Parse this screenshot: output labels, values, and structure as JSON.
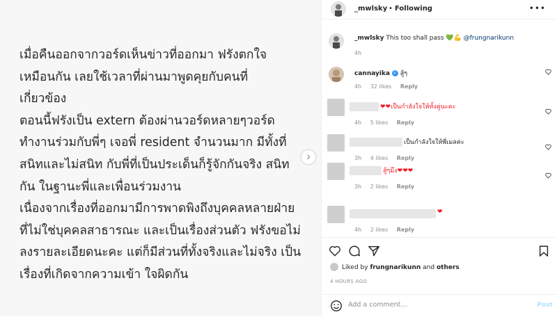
{
  "post_image": {
    "lines": [
      "เมื่อคืนออกจากวอร์ดเห็นข่าวที่ออกมา ฟรังตกใจ",
      "เหมือนกัน  เลยใช้เวลาที่ผ่านมาพูดคุยกับคนที่",
      "เกี่ยวข้อง",
      "ตอนนี้ฟรังเป็น extern ต้องผ่านวอร์ดหลายๆวอร์ด",
      "ทำงานร่วมกับพี่ๆ เจอพี่ resident จำนวนมาก มีทั้งที่",
      "สนิทและไม่สนิท กับพี่ที่เป็นประเด็นก็รู้จักกันจริง สนิท",
      "กัน  ในฐานะพี่และเพื่อนร่วมงาน",
      "เนื่องจากเรื่องที่ออกมามีการพาดพิงถึงบุคคลหลายฝ่าย",
      "ที่ไม่ใช่บุคคลสาธารณะ และเป็นเรื่องส่วนตัว ฟรังขอไม่",
      "ลงรายละเอียดนะคะ แต่ก็มีส่วนที่ทั้งจริงและไม่จริง เป็น",
      "เรื่องที่เกิดจากความเข้า ใจผิดกัน"
    ]
  },
  "header": {
    "username": "_mwlsky",
    "separator": "•",
    "follow_status": "Following",
    "more_icon": "more-horizontal-icon"
  },
  "caption": {
    "username": "_mwlsky",
    "text": "This too shall pass",
    "emojis": "💚💪",
    "mention": "@frungnarikunn",
    "time": "4h"
  },
  "comments": [
    {
      "username": "cannayika",
      "verified": true,
      "text": "สู้ๆ",
      "time": "4h",
      "likes": "32 likes",
      "reply": "Reply"
    },
    {
      "username": "",
      "text": "❤❤เป็นกำลังใจให้ทั้งคู่นะคะ",
      "time": "4h",
      "likes": "5 likes",
      "reply": "Reply"
    },
    {
      "username": "",
      "text": "เป็นกำลังใจให้พี่เมลค่ะ",
      "time": "3h",
      "likes": "4 likes",
      "reply": "Reply"
    },
    {
      "username": "",
      "text": "สู้ๆมึง❤❤❤",
      "time": "3h",
      "likes": "2 likes",
      "reply": "Reply"
    },
    {
      "username": "",
      "text": "❤",
      "time": "4h",
      "likes": "2 likes",
      "reply": "Reply"
    }
  ],
  "likes_line": {
    "prefix": "Liked by",
    "user": "frungnarikunn",
    "joiner": "and",
    "others": "others"
  },
  "timestamp": "4 HOURS AGO",
  "add_comment": {
    "placeholder": "Add a comment…",
    "post_label": "Post"
  },
  "colors": {
    "heart_red": "#ed1c24",
    "link_blue": "#00376b",
    "post_button": "#b2dffc",
    "verified_blue": "#3897f0",
    "muted_text": "#8e8e8e"
  }
}
